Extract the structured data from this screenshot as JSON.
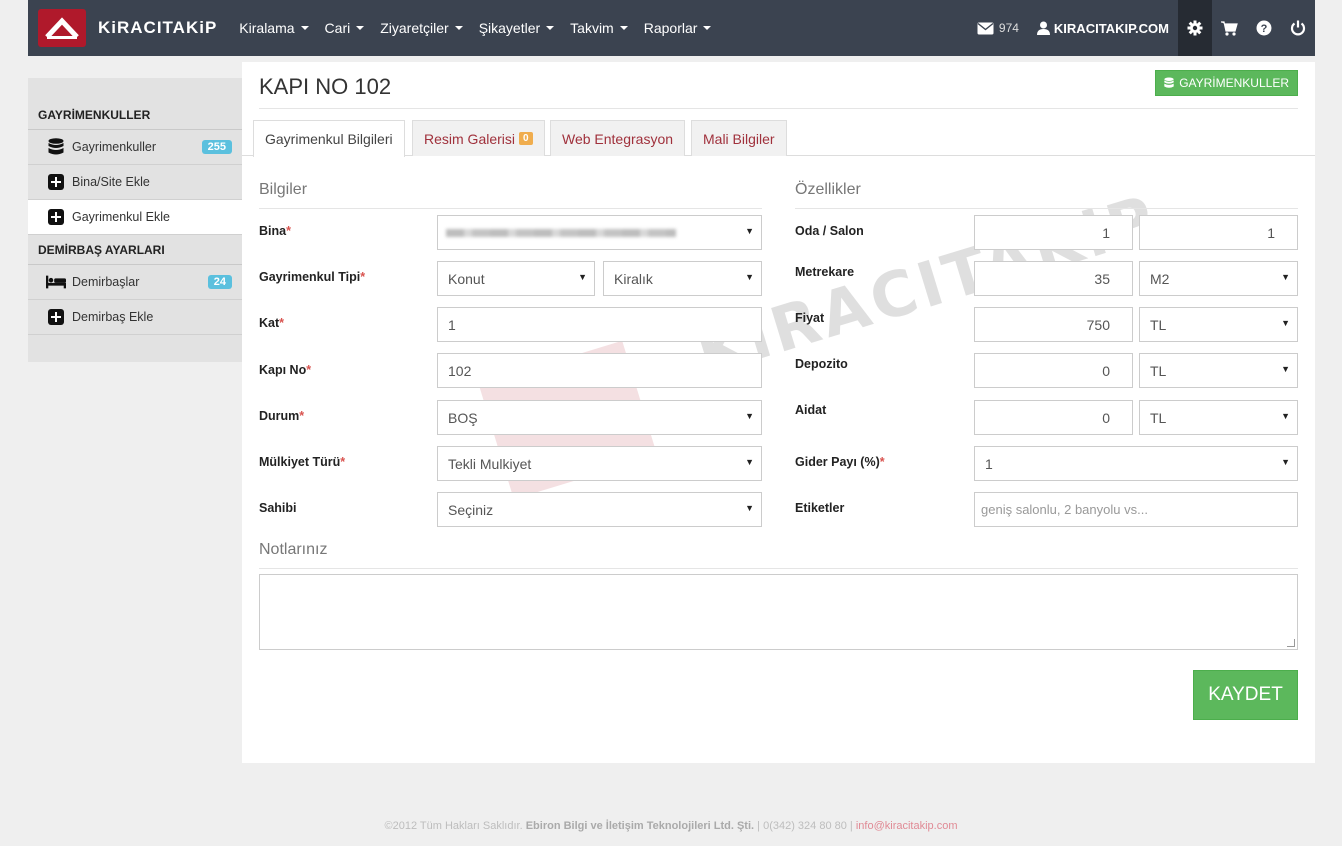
{
  "brand": {
    "name": "KiRACITAKiP"
  },
  "nav": {
    "items": [
      {
        "label": "Kiralama"
      },
      {
        "label": "Cari"
      },
      {
        "label": "Ziyaretçiler"
      },
      {
        "label": "Şikayetler"
      },
      {
        "label": "Takvim"
      },
      {
        "label": "Raporlar"
      }
    ],
    "messages_count": "974",
    "user": "KIRACITAKIP.COM"
  },
  "sidebar": {
    "section1": "GAYRİMENKULLER",
    "items1": [
      {
        "label": "Gayrimenkuller",
        "badge": "255",
        "icon": "database-icon"
      },
      {
        "label": "Bina/Site Ekle",
        "icon": "plus-square-icon"
      },
      {
        "label": "Gayrimenkul Ekle",
        "icon": "plus-square-icon"
      }
    ],
    "section2": "DEMİRBAŞ AYARLARI",
    "items2": [
      {
        "label": "Demirbaşlar",
        "badge": "24",
        "icon": "bed-icon"
      },
      {
        "label": "Demirbaş Ekle",
        "icon": "plus-square-icon"
      }
    ]
  },
  "page": {
    "title": "KAPI NO 102",
    "top_button": "GAYRİMENKULLER",
    "tabs": [
      {
        "label": "Gayrimenkul Bilgileri"
      },
      {
        "label": "Resim Galerisi",
        "badge": "0"
      },
      {
        "label": "Web Entegrasyon"
      },
      {
        "label": "Mali Bilgiler"
      }
    ]
  },
  "bilgiler": {
    "title": "Bilgiler",
    "bina_label": "Bina",
    "tip_label": "Gayrimenkul Tipi",
    "tip_value": "Konut",
    "tip2_value": "Kiralık",
    "kat_label": "Kat",
    "kat_value": "1",
    "kapi_label": "Kapı No",
    "kapi_value": "102",
    "durum_label": "Durum",
    "durum_value": "BOŞ",
    "mulkiyet_label": "Mülkiyet Türü",
    "mulkiyet_value": "Tekli Mulkiyet",
    "sahibi_label": "Sahibi",
    "sahibi_value": "Seçiniz"
  },
  "ozellikler": {
    "title": "Özellikler",
    "oda_label": "Oda / Salon",
    "oda_value": "1",
    "salon_value": "1",
    "metrekare_label": "Metrekare",
    "metrekare_value": "35",
    "metrekare_unit": "M2",
    "fiyat_label": "Fiyat",
    "fiyat_value": "750",
    "fiyat_currency": "TL",
    "depozito_label": "Depozito",
    "depozito_value": "0",
    "depozito_currency": "TL",
    "aidat_label": "Aidat",
    "aidat_value": "0",
    "aidat_currency": "TL",
    "gider_label": "Gider Payı (%)",
    "gider_value": "1",
    "etiket_label": "Etiketler",
    "etiket_placeholder": "geniş salonlu, 2 banyolu vs..."
  },
  "notes": {
    "title": "Notlarınız"
  },
  "save_button": "KAYDET",
  "watermark": "KiRACITAKiP",
  "footer": {
    "copyright": "©2012 Tüm Hakları Saklıdır.",
    "company": "Ebiron Bilgi ve İletişim Teknolojileri Ltd. Şti.",
    "phone": "| 0(342) 324 80 80 |",
    "email": "info@kiracitakip.com"
  },
  "colors": {
    "navbar": "#3b4350",
    "brand_red": "#b0192b",
    "success": "#5cb85c",
    "info_badge": "#5bc0de",
    "warning_badge": "#f0ad4e"
  }
}
